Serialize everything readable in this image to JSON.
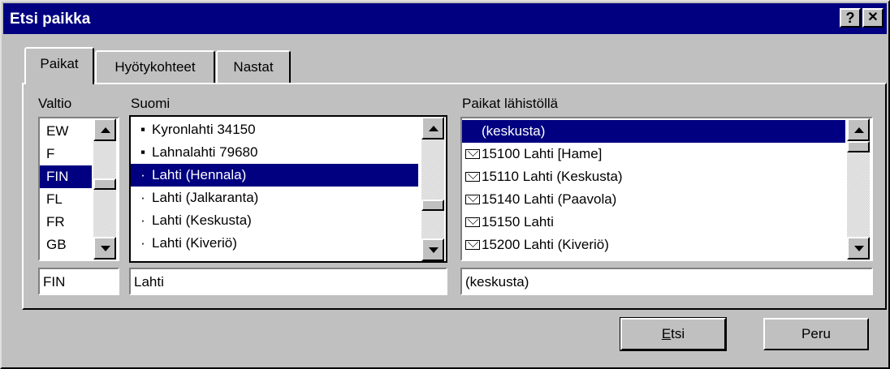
{
  "window": {
    "title": "Etsi paikka",
    "help_label": "?",
    "close_label": "✕"
  },
  "tabs": [
    {
      "label": "Paikat",
      "active": true
    },
    {
      "label": "Hyötykohteet",
      "active": false
    },
    {
      "label": "Nastat",
      "active": false
    }
  ],
  "country": {
    "label": "Valtio",
    "items": [
      "EW",
      "F",
      "FIN",
      "FL",
      "FR",
      "GB"
    ],
    "selected_index": 2,
    "value": "FIN"
  },
  "places": {
    "label": "Suomi",
    "items": [
      {
        "bullet": "▪",
        "text": "Kyronlahti 34150"
      },
      {
        "bullet": "▪",
        "text": "Lahnalahti 79680"
      },
      {
        "bullet": "·",
        "text": "Lahti (Hennala)"
      },
      {
        "bullet": "·",
        "text": "Lahti (Jalkaranta)"
      },
      {
        "bullet": "·",
        "text": "Lahti (Keskusta)"
      },
      {
        "bullet": "·",
        "text": "Lahti (Kiveriö)"
      }
    ],
    "selected_index": 2,
    "value": "Lahti"
  },
  "nearby": {
    "label": "Paikat lähistöllä",
    "items": [
      {
        "icon": "none",
        "text": "(keskusta)"
      },
      {
        "icon": "envelope-icon",
        "text": "15100 Lahti [Hame]"
      },
      {
        "icon": "envelope-icon",
        "text": "15110 Lahti (Keskusta)"
      },
      {
        "icon": "envelope-icon",
        "text": "15140 Lahti (Paavola)"
      },
      {
        "icon": "envelope-icon",
        "text": "15150 Lahti"
      },
      {
        "icon": "envelope-icon",
        "text": "15200 Lahti (Kiveriö)"
      }
    ],
    "selected_index": 0,
    "value": "(keskusta)"
  },
  "buttons": {
    "search": "Etsi",
    "search_mnemonic": "E",
    "cancel": "Peru"
  },
  "colors": {
    "selection": "#000080",
    "face": "#c0c0c0"
  }
}
